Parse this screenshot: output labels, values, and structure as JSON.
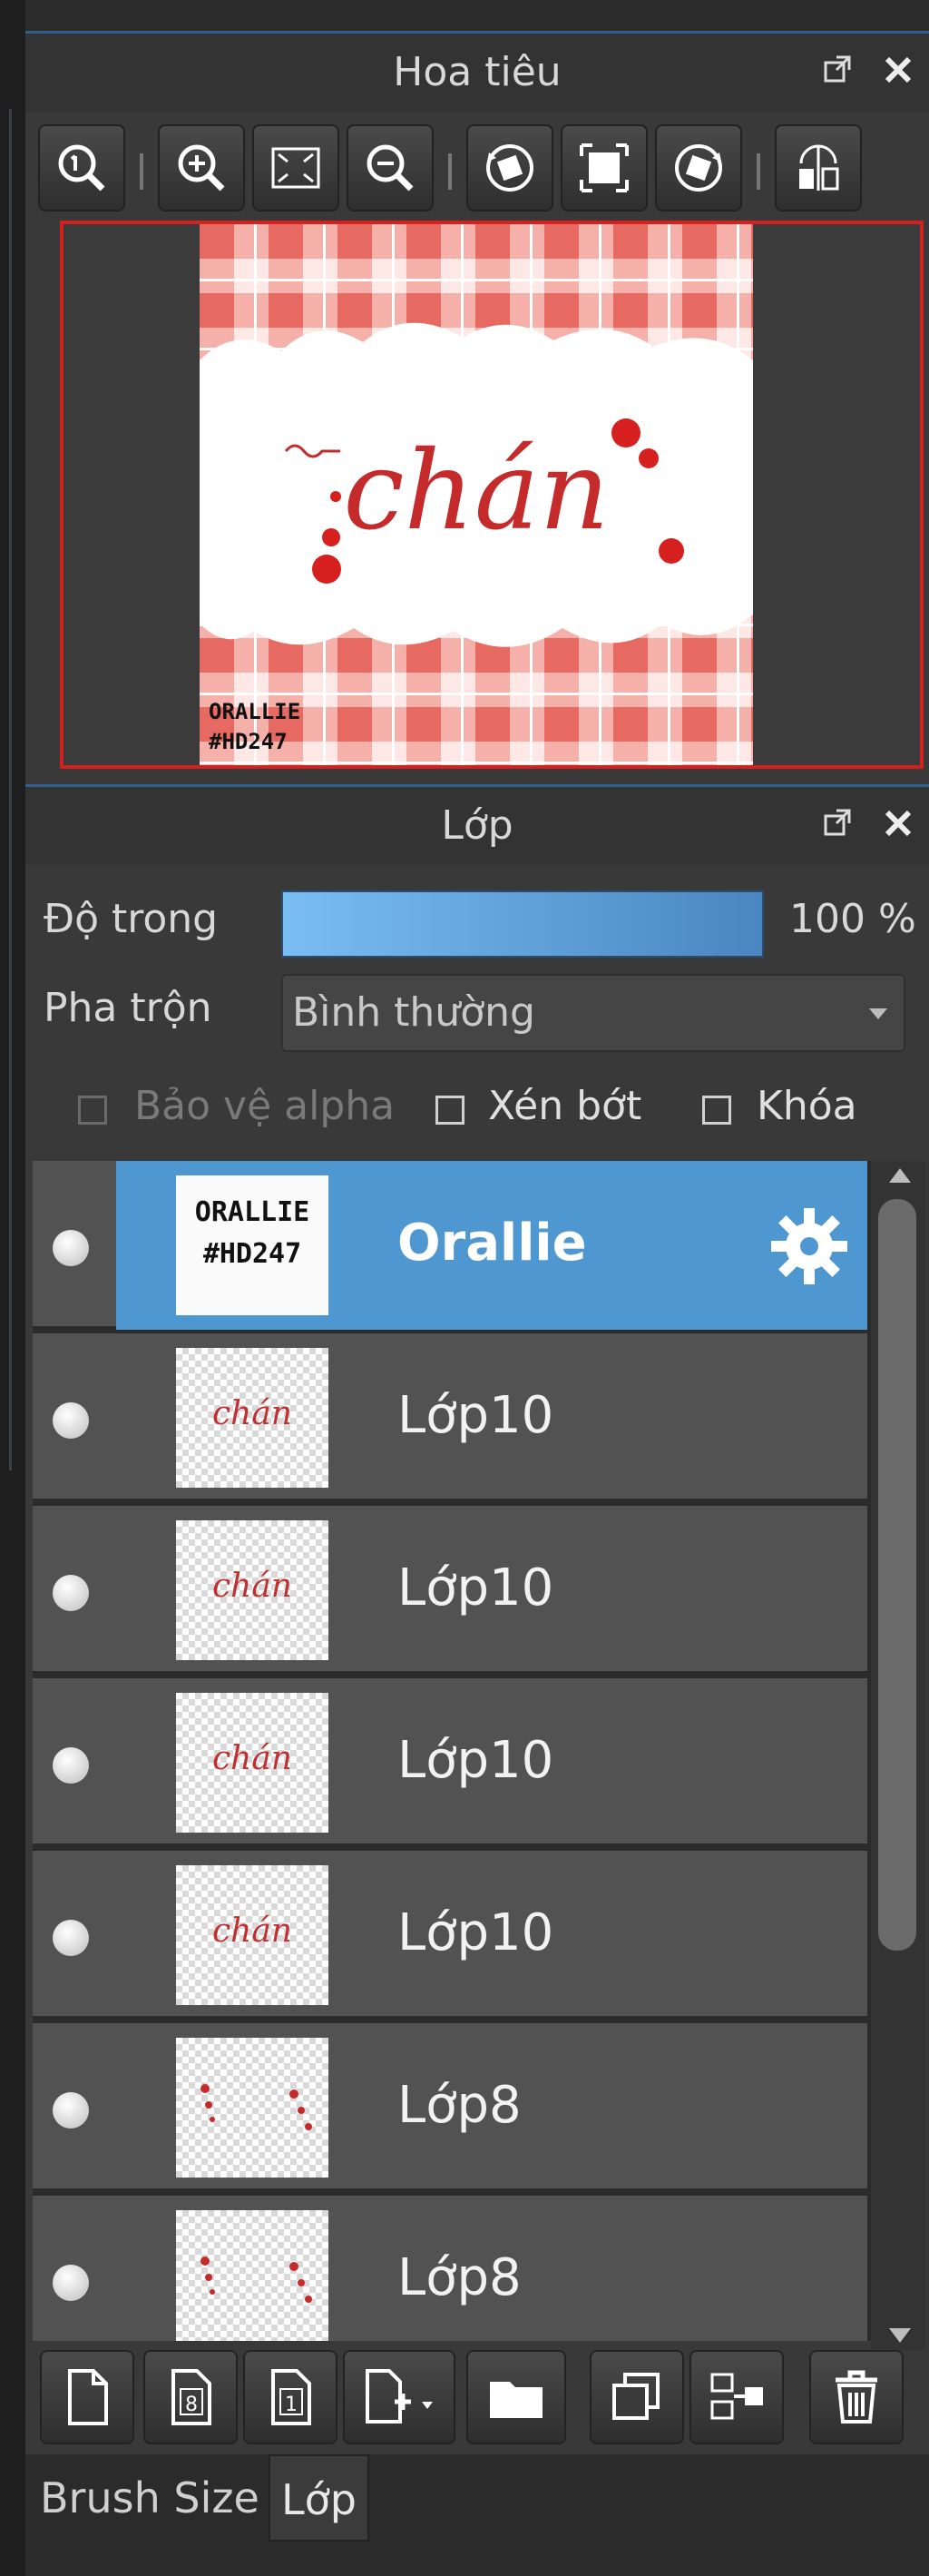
{
  "navigator": {
    "title": "Hoa tiêu",
    "title_icons": [
      "popout-icon",
      "close-icon"
    ],
    "toolbar": [
      "zoom-actual-icon",
      "zoom-in-icon",
      "fit-screen-icon",
      "zoom-out-icon",
      "rotate-left-icon",
      "fit-window-icon",
      "rotate-right-icon",
      "flip-horizontal-icon"
    ],
    "canvas_preview": {
      "text": "chán",
      "stamp_line1": "ORALLIE",
      "stamp_line2": "#HD247"
    }
  },
  "layers_panel": {
    "title": "Lớp",
    "opacity_label": "Độ trong",
    "opacity_value": "100 %",
    "opacity_level": 1.0,
    "blend_label": "Pha trộn",
    "blend_value": "Bình thường",
    "checkboxes": [
      {
        "label": "Bảo vệ alpha",
        "checked": false,
        "enabled": false
      },
      {
        "label": "Xén bớt",
        "checked": false,
        "enabled": true
      },
      {
        "label": "Khóa",
        "checked": false,
        "enabled": true
      }
    ],
    "layers": [
      {
        "name": "Orallie",
        "selected": true,
        "thumb_type": "stamp",
        "thumb_line1": "ORALLIE",
        "thumb_line2": "#HD247"
      },
      {
        "name": "Lớp10",
        "selected": false,
        "thumb_type": "text",
        "thumb_text": "chán"
      },
      {
        "name": "Lớp10",
        "selected": false,
        "thumb_type": "text",
        "thumb_text": "chán"
      },
      {
        "name": "Lớp10",
        "selected": false,
        "thumb_type": "text",
        "thumb_text": "chán"
      },
      {
        "name": "Lớp10",
        "selected": false,
        "thumb_type": "text",
        "thumb_text": "chán"
      },
      {
        "name": "Lớp8",
        "selected": false,
        "thumb_type": "dots"
      },
      {
        "name": "Lớp8",
        "selected": false,
        "thumb_type": "dots"
      }
    ],
    "bottom_toolbar": [
      "new-layer-icon",
      "new-8bit-layer-icon",
      "new-1bit-layer-icon",
      "add-layer-menu-icon",
      "new-folder-icon",
      "duplicate-layer-icon",
      "merge-down-icon",
      "delete-layer-icon"
    ],
    "badge_8": "8",
    "badge_1": "1"
  },
  "tabs": [
    {
      "label": "Brush Size",
      "active": false
    },
    {
      "label": "Lớp",
      "active": true
    }
  ],
  "colors": {
    "selection": "#4f97d1",
    "accent_red": "#d52020",
    "panel_bg": "#393939"
  }
}
